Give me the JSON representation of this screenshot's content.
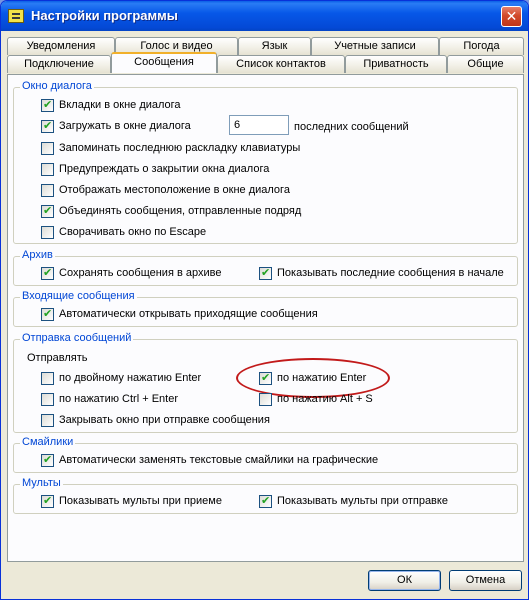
{
  "window": {
    "title": "Настройки программы",
    "close_glyph": "✕"
  },
  "tabs": {
    "row_back": [
      "Уведомления",
      "Голос и видео",
      "Язык",
      "Учетные записи",
      "Погода"
    ],
    "row_front": [
      "Подключение",
      "Сообщения",
      "Список контактов",
      "Приватность",
      "Общие"
    ],
    "active": "Сообщения"
  },
  "dialog_window": {
    "legend": "Окно диалога",
    "tabs_in_dialog": {
      "label": "Вкладки в окне диалога",
      "checked": true
    },
    "load_in_dialog": {
      "label": "Загружать в окне диалога",
      "checked": true,
      "value": "6",
      "suffix": "последних сообщений"
    },
    "remember_layout": {
      "label": "Запоминать последнюю раскладку клавиатуры",
      "checked": false
    },
    "warn_close": {
      "label": "Предупреждать о закрытии окна диалога",
      "checked": false
    },
    "show_location": {
      "label": "Отображать местоположение в окне диалога",
      "checked": false
    },
    "merge_messages": {
      "label": "Объединять сообщения, отправленные подряд",
      "checked": true
    },
    "minimize_escape": {
      "label": "Сворачивать окно по Escape",
      "checked": false
    }
  },
  "archive": {
    "legend": "Архив",
    "save_archive": {
      "label": "Сохранять сообщения в архиве",
      "checked": true
    },
    "show_recent": {
      "label": "Показывать последние сообщения в начале",
      "checked": true
    }
  },
  "incoming": {
    "legend": "Входящие сообщения",
    "auto_open": {
      "label": "Автоматически открывать приходящие сообщения",
      "checked": true
    }
  },
  "sending": {
    "legend": "Отправка сообщений",
    "send_label": "Отправлять",
    "double_enter": {
      "label": "по двойному нажатию Enter",
      "checked": false
    },
    "enter": {
      "label": "по нажатию Enter",
      "checked": true
    },
    "ctrl_enter": {
      "label": "по нажатию Ctrl + Enter",
      "checked": false
    },
    "alt_s": {
      "label": "по нажатию Alt + S",
      "checked": false
    },
    "close_after_send": {
      "label": "Закрывать окно при отправке сообщения",
      "checked": false
    }
  },
  "smileys": {
    "legend": "Смайлики",
    "auto_replace": {
      "label": "Автоматически заменять текстовые смайлики на графические",
      "checked": true
    }
  },
  "cartoons": {
    "legend": "Мульты",
    "show_receive": {
      "label": "Показывать мульты при приеме",
      "checked": true
    },
    "show_send": {
      "label": "Показывать мульты при отправке",
      "checked": true
    }
  },
  "buttons": {
    "ok": "ОК",
    "cancel": "Отмена"
  },
  "colors": {
    "accent": "#0046d5",
    "highlight": "#c21a1a",
    "check": "#21a121"
  }
}
